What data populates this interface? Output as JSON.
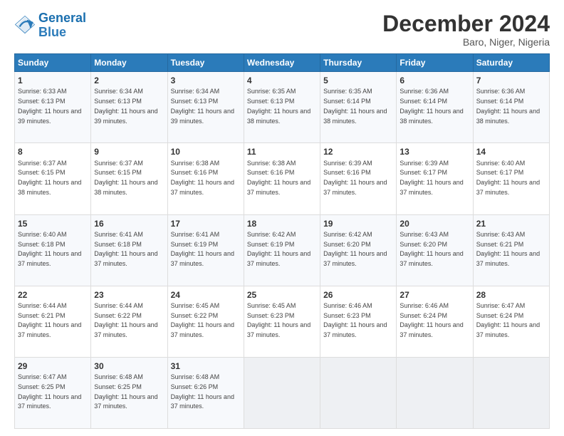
{
  "logo": {
    "line1": "General",
    "line2": "Blue"
  },
  "title": "December 2024",
  "subtitle": "Baro, Niger, Nigeria",
  "days": [
    "Sunday",
    "Monday",
    "Tuesday",
    "Wednesday",
    "Thursday",
    "Friday",
    "Saturday"
  ],
  "weeks": [
    [
      {
        "day": "1",
        "sunrise": "6:33 AM",
        "sunset": "6:13 PM",
        "daylight": "11 hours and 39 minutes."
      },
      {
        "day": "2",
        "sunrise": "6:34 AM",
        "sunset": "6:13 PM",
        "daylight": "11 hours and 39 minutes."
      },
      {
        "day": "3",
        "sunrise": "6:34 AM",
        "sunset": "6:13 PM",
        "daylight": "11 hours and 39 minutes."
      },
      {
        "day": "4",
        "sunrise": "6:35 AM",
        "sunset": "6:13 PM",
        "daylight": "11 hours and 38 minutes."
      },
      {
        "day": "5",
        "sunrise": "6:35 AM",
        "sunset": "6:14 PM",
        "daylight": "11 hours and 38 minutes."
      },
      {
        "day": "6",
        "sunrise": "6:36 AM",
        "sunset": "6:14 PM",
        "daylight": "11 hours and 38 minutes."
      },
      {
        "day": "7",
        "sunrise": "6:36 AM",
        "sunset": "6:14 PM",
        "daylight": "11 hours and 38 minutes."
      }
    ],
    [
      {
        "day": "8",
        "sunrise": "6:37 AM",
        "sunset": "6:15 PM",
        "daylight": "11 hours and 38 minutes."
      },
      {
        "day": "9",
        "sunrise": "6:37 AM",
        "sunset": "6:15 PM",
        "daylight": "11 hours and 38 minutes."
      },
      {
        "day": "10",
        "sunrise": "6:38 AM",
        "sunset": "6:16 PM",
        "daylight": "11 hours and 37 minutes."
      },
      {
        "day": "11",
        "sunrise": "6:38 AM",
        "sunset": "6:16 PM",
        "daylight": "11 hours and 37 minutes."
      },
      {
        "day": "12",
        "sunrise": "6:39 AM",
        "sunset": "6:16 PM",
        "daylight": "11 hours and 37 minutes."
      },
      {
        "day": "13",
        "sunrise": "6:39 AM",
        "sunset": "6:17 PM",
        "daylight": "11 hours and 37 minutes."
      },
      {
        "day": "14",
        "sunrise": "6:40 AM",
        "sunset": "6:17 PM",
        "daylight": "11 hours and 37 minutes."
      }
    ],
    [
      {
        "day": "15",
        "sunrise": "6:40 AM",
        "sunset": "6:18 PM",
        "daylight": "11 hours and 37 minutes."
      },
      {
        "day": "16",
        "sunrise": "6:41 AM",
        "sunset": "6:18 PM",
        "daylight": "11 hours and 37 minutes."
      },
      {
        "day": "17",
        "sunrise": "6:41 AM",
        "sunset": "6:19 PM",
        "daylight": "11 hours and 37 minutes."
      },
      {
        "day": "18",
        "sunrise": "6:42 AM",
        "sunset": "6:19 PM",
        "daylight": "11 hours and 37 minutes."
      },
      {
        "day": "19",
        "sunrise": "6:42 AM",
        "sunset": "6:20 PM",
        "daylight": "11 hours and 37 minutes."
      },
      {
        "day": "20",
        "sunrise": "6:43 AM",
        "sunset": "6:20 PM",
        "daylight": "11 hours and 37 minutes."
      },
      {
        "day": "21",
        "sunrise": "6:43 AM",
        "sunset": "6:21 PM",
        "daylight": "11 hours and 37 minutes."
      }
    ],
    [
      {
        "day": "22",
        "sunrise": "6:44 AM",
        "sunset": "6:21 PM",
        "daylight": "11 hours and 37 minutes."
      },
      {
        "day": "23",
        "sunrise": "6:44 AM",
        "sunset": "6:22 PM",
        "daylight": "11 hours and 37 minutes."
      },
      {
        "day": "24",
        "sunrise": "6:45 AM",
        "sunset": "6:22 PM",
        "daylight": "11 hours and 37 minutes."
      },
      {
        "day": "25",
        "sunrise": "6:45 AM",
        "sunset": "6:23 PM",
        "daylight": "11 hours and 37 minutes."
      },
      {
        "day": "26",
        "sunrise": "6:46 AM",
        "sunset": "6:23 PM",
        "daylight": "11 hours and 37 minutes."
      },
      {
        "day": "27",
        "sunrise": "6:46 AM",
        "sunset": "6:24 PM",
        "daylight": "11 hours and 37 minutes."
      },
      {
        "day": "28",
        "sunrise": "6:47 AM",
        "sunset": "6:24 PM",
        "daylight": "11 hours and 37 minutes."
      }
    ],
    [
      {
        "day": "29",
        "sunrise": "6:47 AM",
        "sunset": "6:25 PM",
        "daylight": "11 hours and 37 minutes."
      },
      {
        "day": "30",
        "sunrise": "6:48 AM",
        "sunset": "6:25 PM",
        "daylight": "11 hours and 37 minutes."
      },
      {
        "day": "31",
        "sunrise": "6:48 AM",
        "sunset": "6:26 PM",
        "daylight": "11 hours and 37 minutes."
      },
      null,
      null,
      null,
      null
    ]
  ]
}
